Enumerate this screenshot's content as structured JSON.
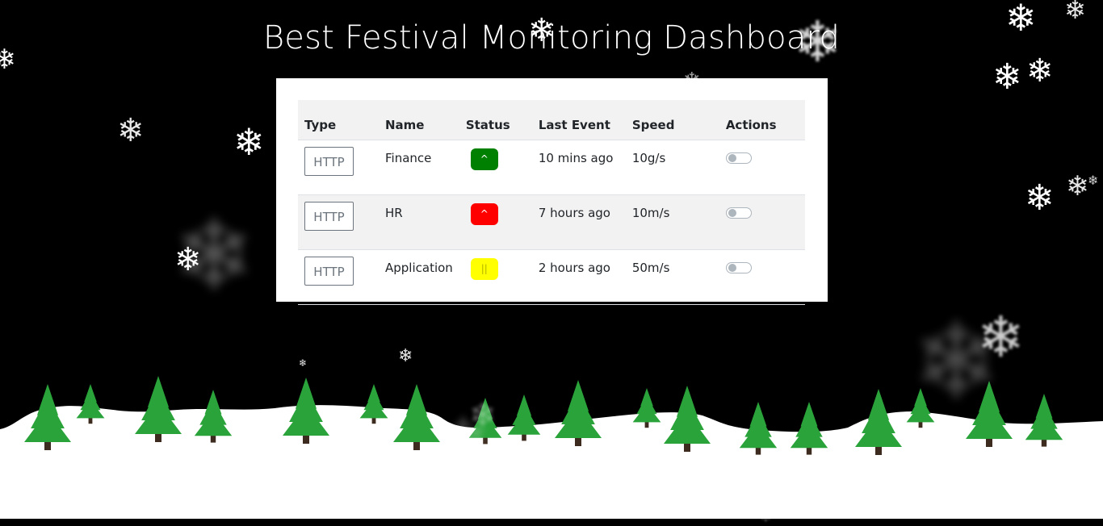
{
  "page": {
    "title": "Best Festival Monitoring Dashboard"
  },
  "table": {
    "columns": [
      "Type",
      "Name",
      "Status",
      "Last Event",
      "Speed",
      "Actions"
    ],
    "rows": [
      {
        "type": "HTTP",
        "name": "Finance",
        "status_symbol": "^",
        "status_color": "#008000",
        "status_text_color": "#ffffff",
        "last_event": "10 mins ago",
        "speed": "10g/s",
        "enabled": false
      },
      {
        "type": "HTTP",
        "name": "HR",
        "status_symbol": "^",
        "status_color": "#ff0000",
        "status_text_color": "#ffffff",
        "last_event": "7 hours ago",
        "speed": "10m/s",
        "enabled": false
      },
      {
        "type": "HTTP",
        "name": "Application",
        "status_symbol": "||",
        "status_color": "#ffff00",
        "status_text_color": "#b3b300",
        "last_event": "2 hours ago",
        "speed": "50m/s",
        "enabled": false
      }
    ]
  },
  "colors": {
    "background": "#000000",
    "snow": "#ffffff",
    "tree": "#2aa33a",
    "trunk": "#3d2b1f"
  },
  "icons": {
    "snowflake": "snowflake-icon",
    "tree": "pine-tree-icon"
  }
}
